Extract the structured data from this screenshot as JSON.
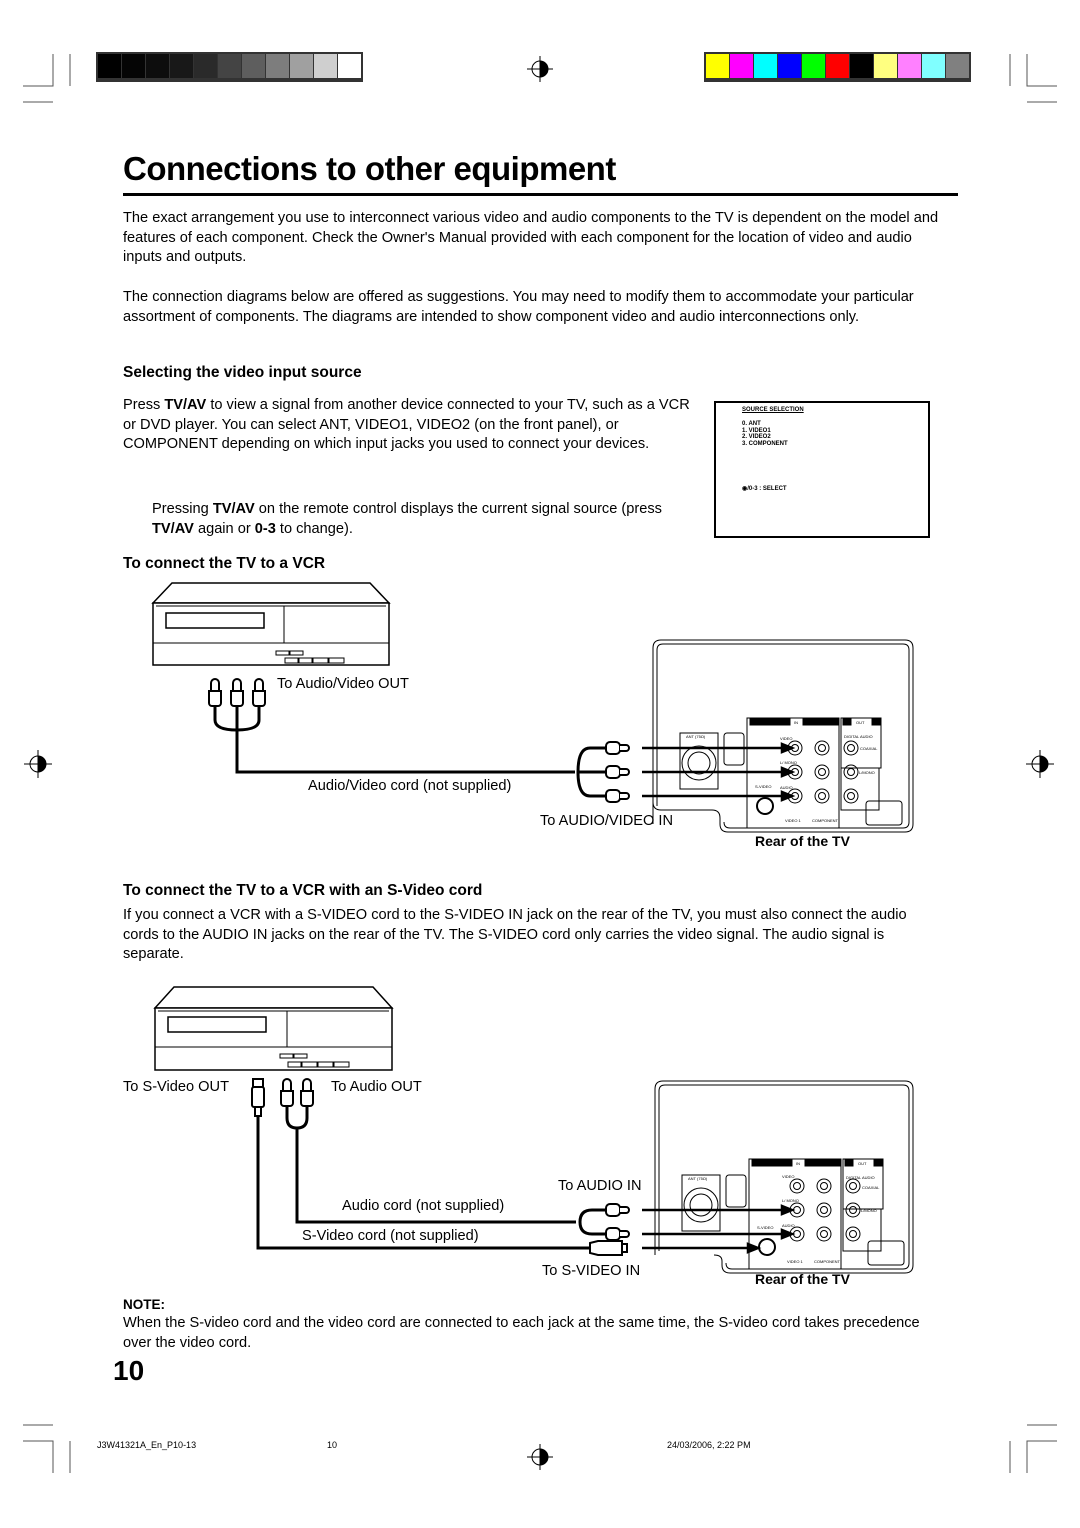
{
  "page": {
    "title": "Connections to other equipment",
    "intro_paragraphs": [
      "The exact arrangement you use to interconnect various video and audio components to the TV is dependent on the model and features of each component. Check the Owner's Manual provided with each component for the location of video and audio inputs and outputs.",
      "The connection diagrams below are offered as suggestions. You may need to modify them to accommodate your particular assortment of components. The diagrams are intended to show component video and audio interconnections only."
    ],
    "page_number": "10"
  },
  "print_marks": {
    "grayscale_colors": [
      "#000000",
      "#050505",
      "#0d0d0d",
      "#181818",
      "#2a2a2a",
      "#444444",
      "#5e5e5e",
      "#7d7d7d",
      "#a0a0a0",
      "#cfcfcf",
      "#ffffff"
    ],
    "color_swatches": [
      "#ffff00",
      "#ff00ff",
      "#00ffff",
      "#0000ff",
      "#00ff00",
      "#ff0000",
      "#000000",
      "#ffff80",
      "#ff80ff",
      "#80ffff",
      "#808080"
    ]
  },
  "section_select": {
    "heading": "Selecting the video input source",
    "para1_parts": [
      "Press ",
      "TV/AV",
      " to view a signal from another device connected to your TV, such as a VCR or DVD player. You can select ANT, VIDEO1, VIDEO2 (on the front panel), or COMPONENT depending on which input jacks you used to connect your devices."
    ],
    "para2_parts": [
      "Pressing ",
      "TV/AV",
      " on the remote control displays the current signal source (press ",
      "TV/AV",
      " again or ",
      "0-3",
      " to change)."
    ],
    "osd": {
      "title": "SOURCE SELECTION",
      "items": [
        "0.  ANT",
        "1.  VIDEO1",
        "2.  VIDEO2",
        "3.  COMPONENT"
      ],
      "select_hint": "/0-3 : SELECT"
    }
  },
  "section_vcr": {
    "heading": "To connect the TV to a VCR",
    "label_av_out": "To Audio/Video OUT",
    "label_cord": "Audio/Video cord (not supplied)",
    "label_av_in": "To AUDIO/VIDEO IN",
    "label_rear": "Rear of the TV"
  },
  "section_svideo": {
    "heading": "To connect the TV to a VCR with an S-Video cord",
    "paragraph": "If you connect a VCR with a S-VIDEO cord to the S-VIDEO IN jack on the rear of the TV, you must also connect the audio cords to the AUDIO IN jacks on the rear of the TV. The S-VIDEO cord only carries the video signal. The audio signal is separate.",
    "label_svideo_out": "To S-Video OUT",
    "label_audio_out": "To Audio OUT",
    "label_audio_in": "To AUDIO IN",
    "label_audio_cord": "Audio cord (not supplied)",
    "label_svideo_cord": "S-Video cord (not supplied)",
    "label_svideo_in": "To S-VIDEO IN",
    "label_rear": "Rear of the TV"
  },
  "tv_rear_panel": {
    "in_label": "IN",
    "out_label": "OUT",
    "ant_label": "ANT (75Ω)",
    "video_label": "VIDEO",
    "l_mono_label": "L/ MONO",
    "audio_label": "AUDIO",
    "r_label": "R",
    "svideo_label": "S-VIDEO",
    "video1_label": "VIDEO 1",
    "component_label": "COMPONENT",
    "y_label": "Y",
    "pb_label": "Pb",
    "pr_label": "Pr",
    "digital_audio_label": "DIGITAL AUDIO",
    "coaxial_label": "COAXIAL",
    "lmono_out_label": "L/MONO",
    "audio_out_label": "AUDIO",
    "r_out_label": "R"
  },
  "note": {
    "label": "NOTE:",
    "text": "When the S-video cord and the video cord are connected to each jack at the same time, the S-video cord takes precedence over the video cord."
  },
  "footer": {
    "file": "J3W41321A_En_P10-13",
    "page": "10",
    "datetime": "24/03/2006, 2:22 PM"
  }
}
